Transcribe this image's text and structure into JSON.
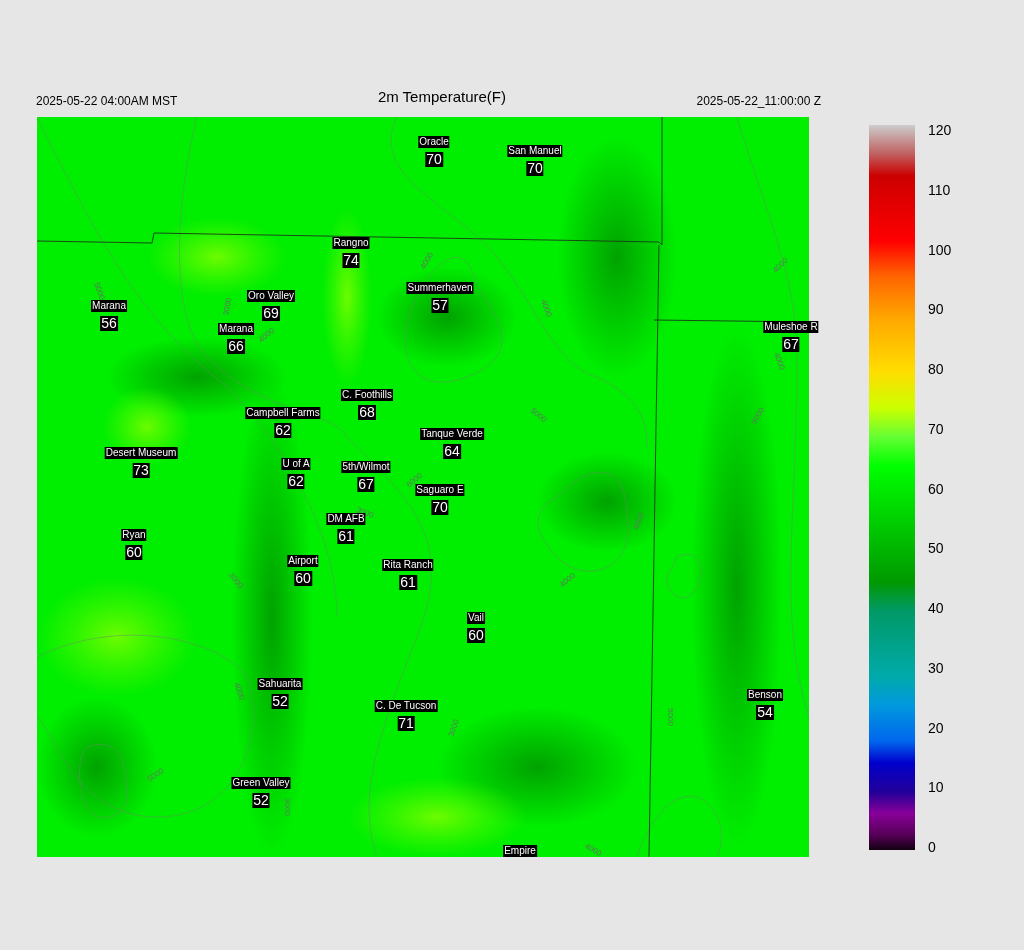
{
  "header": {
    "left": "2025-05-22 04:00AM MST",
    "title": "2m Temperature(F)",
    "right": "2025-05-22_11:00:00 Z"
  },
  "stations": [
    {
      "name": "Oracle",
      "value": "70"
    },
    {
      "name": "San Manuel",
      "value": "70"
    },
    {
      "name": "Rangno",
      "value": "74"
    },
    {
      "name": "Summerhaven",
      "value": "57"
    },
    {
      "name": "Marana",
      "value": "56"
    },
    {
      "name": "Oro Valley",
      "value": "69"
    },
    {
      "name": "Marana",
      "value": "66"
    },
    {
      "name": "Muleshoe R",
      "value": "67"
    },
    {
      "name": "C. Foothills",
      "value": "68"
    },
    {
      "name": "Campbell Farms",
      "value": "62"
    },
    {
      "name": "Tanque Verde",
      "value": "64"
    },
    {
      "name": "Desert Museum",
      "value": "73"
    },
    {
      "name": "U of A",
      "value": "62"
    },
    {
      "name": "5th/Wilmot",
      "value": "67"
    },
    {
      "name": "Saguaro E",
      "value": "70"
    },
    {
      "name": "DM AFB",
      "value": "61"
    },
    {
      "name": "Ryan",
      "value": "60"
    },
    {
      "name": "Airport",
      "value": "60"
    },
    {
      "name": "Rita Ranch",
      "value": "61"
    },
    {
      "name": "Vail",
      "value": "60"
    },
    {
      "name": "Sahuarita",
      "value": "52"
    },
    {
      "name": "C. De Tucson",
      "value": "71"
    },
    {
      "name": "Benson",
      "value": "54"
    },
    {
      "name": "Green Valley",
      "value": "52"
    },
    {
      "name": "Empire"
    }
  ],
  "contour_labels": [
    "3000",
    "4000",
    "4000",
    "4000",
    "5000",
    "6000",
    "3000",
    "4000",
    "4000",
    "5000",
    "3000",
    "3000",
    "4000",
    "5000",
    "3000",
    "4000",
    "5000",
    "5000",
    "4000",
    "4000"
  ],
  "colorbar": {
    "ticks": [
      "120",
      "110",
      "100",
      "90",
      "80",
      "70",
      "60",
      "50",
      "40",
      "30",
      "20",
      "10",
      "0"
    ]
  }
}
